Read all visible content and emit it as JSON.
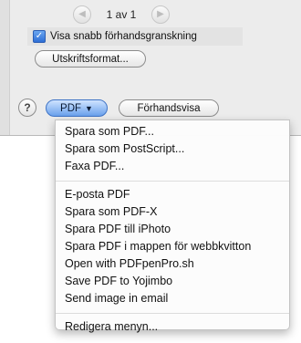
{
  "dialog": {
    "pager": {
      "prev_icon": "left-arrow-icon",
      "next_icon": "right-arrow-icon",
      "page_label": "1 av 1"
    },
    "quick_preview": {
      "label": "Visa snabb förhandsgranskning",
      "checked": true
    },
    "page_format_button": "Utskriftsformat...",
    "help_button": "?",
    "pdf_button": "PDF",
    "pdf_arrow": "▼",
    "preview_button": "Förhandsvisa"
  },
  "pdf_menu": {
    "group1": [
      "Spara som PDF...",
      "Spara som PostScript...",
      "Faxa PDF..."
    ],
    "group2": [
      "E-posta PDF",
      "Spara som PDF-X",
      "Spara PDF till iPhoto",
      "Spara PDF i mappen för webbkvitton",
      "Open with PDFpenPro.sh",
      "Save PDF to Yojimbo",
      "Send image in email"
    ],
    "group3": [
      "Redigera menyn..."
    ]
  },
  "colors": {
    "sheet_bg": "#ececec",
    "pdf_button_blue": "#6aa1ec",
    "checkbox_blue": "#2f6fd6"
  }
}
